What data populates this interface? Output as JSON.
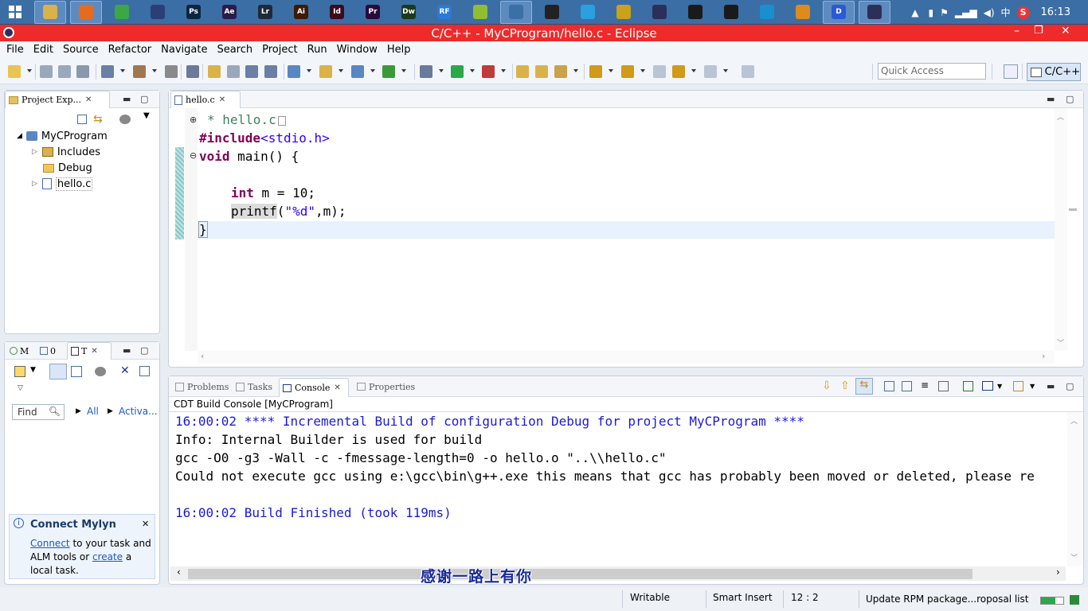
{
  "taskbar": {
    "apps": [
      {
        "name": "file-explorer",
        "label": "",
        "color": "#d9b24a",
        "active": true
      },
      {
        "name": "firefox",
        "label": "",
        "color": "#e66b1f",
        "active": true
      },
      {
        "name": "chrome",
        "label": "",
        "color": "#3ba745",
        "active": false
      },
      {
        "name": "app-circle",
        "label": "",
        "color": "#2c3e78",
        "active": false
      },
      {
        "name": "photoshop",
        "label": "Ps",
        "color": "#0b2740",
        "active": false
      },
      {
        "name": "after-effects",
        "label": "Ae",
        "color": "#2b1b4a",
        "active": false
      },
      {
        "name": "lightroom",
        "label": "Lr",
        "color": "#1e2a3a",
        "active": false
      },
      {
        "name": "illustrator",
        "label": "Ai",
        "color": "#3b1a06",
        "active": false
      },
      {
        "name": "indesign",
        "label": "Id",
        "color": "#3a0a1e",
        "active": false
      },
      {
        "name": "premiere",
        "label": "Pr",
        "color": "#2a0a3a",
        "active": false
      },
      {
        "name": "dreamweaver",
        "label": "Dw",
        "color": "#1a3a1a",
        "active": false
      },
      {
        "name": "app-rf",
        "label": "RF",
        "color": "#2a7ad8",
        "active": false
      },
      {
        "name": "app-ball",
        "label": "",
        "color": "#8fbf2f",
        "active": false
      },
      {
        "name": "python",
        "label": "",
        "color": "#3b6fa8",
        "active": true
      },
      {
        "name": "qq",
        "label": "",
        "color": "#222222",
        "active": false
      },
      {
        "name": "app-link",
        "label": "",
        "color": "#2aa0e0",
        "active": false
      },
      {
        "name": "app-face",
        "label": "",
        "color": "#c9a21a",
        "active": false
      },
      {
        "name": "eclipse-task",
        "label": "",
        "color": "#2c2f5a",
        "active": false
      },
      {
        "name": "app-vim",
        "label": "",
        "color": "#1a1a1a",
        "active": false
      },
      {
        "name": "app-pin",
        "label": "",
        "color": "#1a1a1a",
        "active": false
      },
      {
        "name": "app-zero",
        "label": "",
        "color": "#1a8fd0",
        "active": false
      },
      {
        "name": "app-fox",
        "label": "",
        "color": "#e08a1a",
        "active": false
      },
      {
        "name": "app-d",
        "label": "D",
        "color": "#2a5ad8",
        "active": true
      },
      {
        "name": "eclipse-active",
        "label": "",
        "color": "#2c2f5a",
        "active": true
      }
    ],
    "time": "16:13",
    "ime": "中"
  },
  "window": {
    "title": "C/C++ - MyCProgram/hello.c - Eclipse"
  },
  "menu": [
    "File",
    "Edit",
    "Source",
    "Refactor",
    "Navigate",
    "Search",
    "Project",
    "Run",
    "Window",
    "Help"
  ],
  "quick_access": {
    "placeholder": "Quick Access"
  },
  "perspective": {
    "label": "C/C++"
  },
  "project_explorer": {
    "tab_label": "Project Exp...",
    "root": "MyCProgram",
    "items": [
      "Includes",
      "Debug",
      "hello.c"
    ]
  },
  "bottom_left": {
    "tabs": [
      "M",
      "0",
      "T"
    ],
    "find_placeholder": "Find",
    "all_label": "All",
    "activate_label": "Activa..."
  },
  "mylyn": {
    "title": "Connect Mylyn",
    "connect": "Connect",
    "text1": " to your task and",
    "text2": "ALM tools or ",
    "create": "create",
    "text3": " a",
    "text4": "local task."
  },
  "editor": {
    "tab_label": "hello.c",
    "lines": {
      "comment": "* hello.c",
      "include_kw": "#include",
      "include_path": "<stdio.h>",
      "void_kw": "void",
      "main_decl": " main() {",
      "int_kw": "int",
      "int_rest": " m = 10;",
      "printf": "printf",
      "printf_open": "(",
      "printf_str": "\"%d\"",
      "printf_rest": ",m);",
      "close": "}"
    }
  },
  "console": {
    "tabs": [
      "Problems",
      "Tasks",
      "Console",
      "Properties"
    ],
    "header": "CDT Build Console [MyCProgram]",
    "lines": [
      "16:00:02 **** Incremental Build of configuration Debug for project MyCProgram ****",
      "Info: Internal Builder is used for build",
      "gcc -O0 -g3 -Wall -c -fmessage-length=0 -o hello.o \"..\\\\hello.c\"",
      "Could not execute gcc using e:\\gcc\\bin\\g++.exe this means that gcc has probably been moved or deleted, please re",
      "16:00:02 Build Finished (took 119ms)"
    ]
  },
  "subtitle": "感谢一路上有你",
  "status": {
    "writable": "Writable",
    "insert": "Smart Insert",
    "position": "12 : 2",
    "task": "Update RPM package...roposal list"
  },
  "colors": {
    "title_bar": "#ee2a2a",
    "keyword": "#7f0055",
    "string": "#2a00ff",
    "comment": "#3f7f5f",
    "console_blue": "#1a1ad8"
  }
}
